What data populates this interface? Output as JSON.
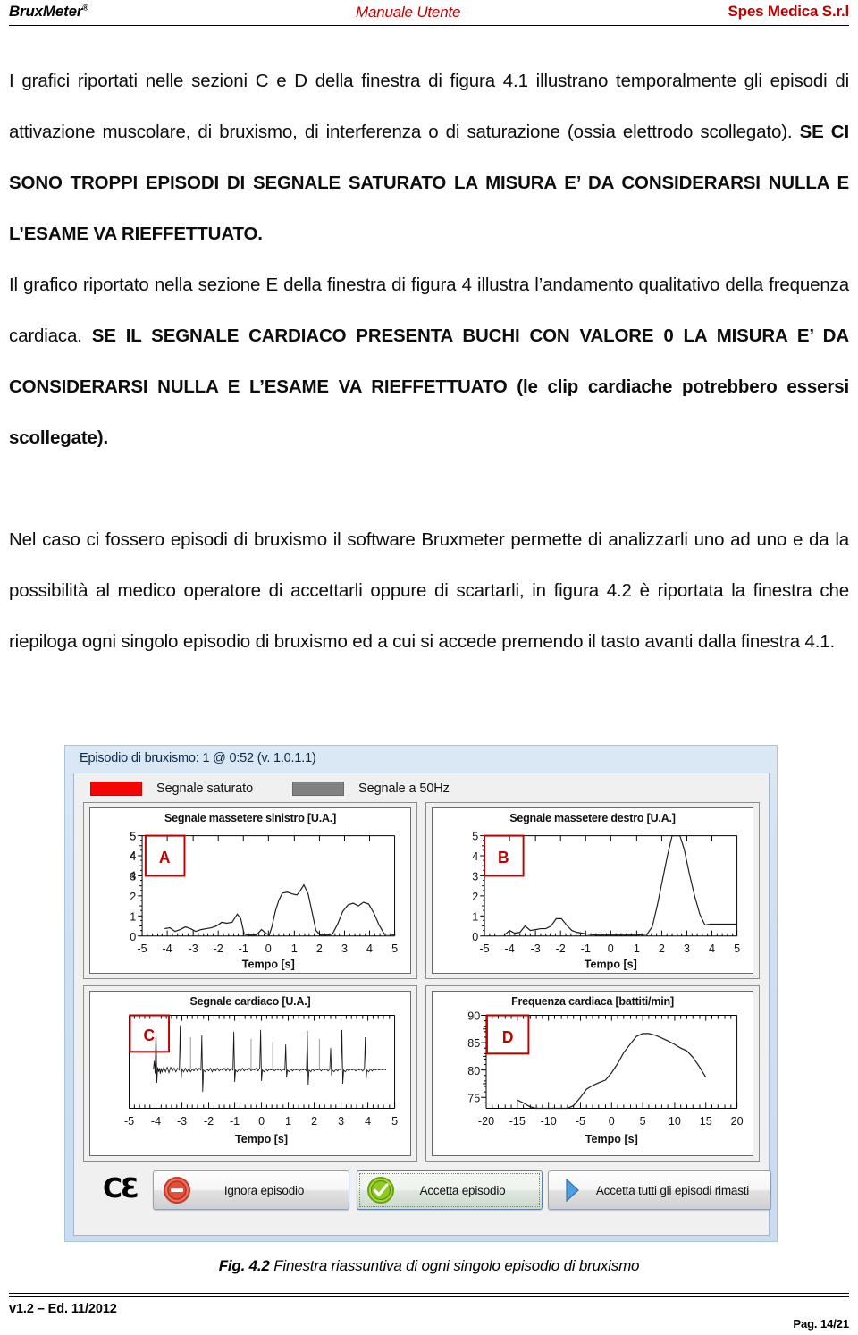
{
  "header": {
    "left": "BruxMeter",
    "left_sup": "®",
    "center": "Manuale Utente",
    "right": "Spes Medica S.r.l",
    "accent_color": "#c00000"
  },
  "body": {
    "para1_a": "I grafici riportati nelle sezioni C e D della finestra di figura 4.1 illustrano temporalmente gli episodi di attivazione muscolare, di bruxismo, di interferenza o di saturazione (ossia elettrodo scollegato). ",
    "para1_b": "SE CI SONO TROPPI EPISODI DI SEGNALE SATURATO LA MISURA E’ DA CONSIDERARSI NULLA E L’ESAME VA RIEFFETTUATO.",
    "para2_a": "Il grafico riportato nella sezione E della finestra di figura 4 illustra l’andamento qualitativo della frequenza cardiaca. ",
    "para2_b": "SE IL SEGNALE  CARDIACO PRESENTA BUCHI CON VALORE 0 LA MISURA E’ DA CONSIDERARSI NULLA E L’ESAME VA RIEFFETTUATO (le clip cardiache potrebbero essersi scollegate).",
    "para3": "Nel caso ci fossero episodi di bruxismo il software Bruxmeter permette di analizzarli uno ad uno e da la possibilità al medico operatore di accettarli oppure di scartarli, in figura 4.2 è riportata la finestra che riepiloga ogni singolo episodio di bruxismo ed a cui si accede premendo il tasto avanti dalla finestra 4.1."
  },
  "figure": {
    "window_title": "Episodio di bruxismo: 1 @ 0:52 (v. 1.0.1.1)",
    "legend": [
      {
        "label": "Segnale saturato",
        "color": "#f50505",
        "swatch": "red"
      },
      {
        "label": "Segnale a 50Hz",
        "color": "#818181",
        "swatch": "gray"
      }
    ],
    "panels": [
      {
        "badge": "A",
        "title": "Segnale massetere sinistro [U.A.]"
      },
      {
        "badge": "B",
        "title": "Segnale massetere destro [U.A.]"
      },
      {
        "badge": "C",
        "title": "Segnale cardiaco [U.A.]"
      },
      {
        "badge": "D",
        "title": "Frequenza cardiaca [battiti/min]"
      }
    ],
    "ce_mark": "CƐ",
    "buttons": [
      {
        "label": "Ignora episodio",
        "icon": "minus-circle-icon",
        "color": "#e04a3c",
        "focused": false
      },
      {
        "label": "Accetta episodio",
        "icon": "check-circle-icon",
        "color": "#7fc41c",
        "focused": true
      },
      {
        "label": "Accetta tutti gli episodi rimasti",
        "icon": "blue-arrow-icon",
        "color": "#3d8fd6",
        "focused": false
      }
    ]
  },
  "caption": {
    "bold": "Fig. 4.2",
    "text": " Finestra riassuntiva di ogni singolo episodio di bruxismo"
  },
  "footer": {
    "left": "v1.2 – Ed. 11/2012",
    "right": "Pag. 14/21"
  },
  "chart_data": [
    {
      "type": "line",
      "panel": "A",
      "title": "Segnale massetere sinistro [U.A.]",
      "xlabel": "Tempo [s]",
      "ylabel": "",
      "xlim": [
        -5,
        5
      ],
      "ylim": [
        0,
        5
      ],
      "xticks": [
        -5,
        -4,
        -3,
        -2,
        -1,
        0,
        1,
        2,
        3,
        4,
        5
      ],
      "yticks": [
        0,
        1,
        2,
        3,
        4,
        5
      ],
      "grid": false,
      "x": [
        -4.1,
        -3.9,
        -3.7,
        -3.5,
        -3.35,
        -3.2,
        -3.05,
        -2.9,
        -2.7,
        -2.5,
        -2.3,
        -2.1,
        -1.9,
        -1.7,
        -1.55,
        -1.45,
        -1.35,
        -1.2,
        -1.0,
        -0.85,
        -0.7,
        -0.6,
        -0.5,
        -0.42,
        -0.3,
        -0.15,
        0.0,
        0.2,
        0.4,
        0.55,
        0.7,
        0.85,
        1.0,
        1.1,
        1.25,
        1.5,
        1.7,
        1.85,
        2.0,
        2.2,
        2.4,
        2.6,
        2.8,
        3.0,
        3.15,
        3.3,
        3.5,
        3.8,
        4.2,
        4.7
      ],
      "y": [
        0.35,
        0.42,
        0.22,
        0.3,
        0.45,
        0.38,
        0.25,
        0.32,
        0.38,
        0.4,
        0.5,
        0.68,
        0.62,
        0.68,
        1.1,
        0.85,
        0.1,
        0.03,
        0.05,
        0.3,
        0.1,
        0.05,
        0.4,
        1.1,
        1.8,
        2.15,
        2.2,
        2.1,
        2.05,
        2.3,
        2.55,
        2.1,
        1.1,
        0.25,
        0.05,
        0.05,
        0.08,
        0.6,
        1.2,
        1.55,
        1.6,
        1.5,
        1.65,
        1.6,
        1.15,
        0.55,
        0.08,
        0.1,
        0.05,
        0.07
      ]
    },
    {
      "type": "line",
      "panel": "B",
      "title": "Segnale massetere destro [U.A.]",
      "xlabel": "Tempo [s]",
      "ylabel": "",
      "xlim": [
        -5,
        5
      ],
      "ylim": [
        0,
        5
      ],
      "xticks": [
        -5,
        -4,
        -3,
        -2,
        -1,
        0,
        1,
        2,
        3,
        4,
        5
      ],
      "yticks": [
        0,
        1,
        2,
        3,
        4,
        5
      ],
      "grid": false,
      "note": "Picco saturato oltre il fondo scala tra 2.3 e 3.0 s",
      "x": [
        -4.2,
        -4.0,
        -3.8,
        -3.6,
        -3.45,
        -3.3,
        -3.15,
        -3.0,
        -2.8,
        -2.6,
        -2.4,
        -2.2,
        -2.05,
        -1.9,
        -1.75,
        -1.6,
        -1.4,
        -1.2,
        -1.0,
        -0.6,
        -0.2,
        0.3,
        0.8,
        1.2,
        1.5,
        1.7,
        1.85,
        2.0,
        2.2,
        2.4,
        2.55,
        2.7,
        2.9,
        3.05,
        3.2,
        3.4,
        3.55,
        3.7,
        4.0
      ],
      "y": [
        0.05,
        0.25,
        0.15,
        0.18,
        0.5,
        0.28,
        0.32,
        0.35,
        0.38,
        0.6,
        0.88,
        0.8,
        0.55,
        0.3,
        0.18,
        0.12,
        0.1,
        0.06,
        0.05,
        0.04,
        0.04,
        0.04,
        0.05,
        0.05,
        0.06,
        0.1,
        0.6,
        1.6,
        2.9,
        4.2,
        5.0,
        5.0,
        4.6,
        3.4,
        2.2,
        1.1,
        0.6,
        0.58,
        0.57
      ]
    },
    {
      "type": "line",
      "panel": "C",
      "title": "Segnale cardiaco [U.A.]",
      "xlabel": "Tempo [s]",
      "ylabel": "",
      "xlim": [
        -5,
        5
      ],
      "ylim": [
        -1,
        1
      ],
      "xticks": [
        -5,
        -4,
        -3,
        -2,
        -1,
        0,
        1,
        2,
        3,
        4,
        5
      ],
      "yticks": [],
      "grid": false,
      "note": "Tracciato ECG con complessi QRS; asse y senza etichette. Picchi R circa a -4.0, -3.35, -2.55, -1.9, -1.2, -0.45, 0.15, 0.95, 1.5, 2.2, 2.95, 3.6 s"
    },
    {
      "type": "line",
      "panel": "D",
      "title": "Frequenza cardiaca [battiti/min]",
      "xlabel": "Tempo [s]",
      "ylabel": "",
      "xlim": [
        -20,
        20
      ],
      "ylim": [
        73,
        90
      ],
      "xticks": [
        -20,
        -15,
        -10,
        -5,
        0,
        5,
        10,
        15,
        20
      ],
      "yticks": [
        75,
        80,
        85,
        90
      ],
      "grid": false,
      "x": [
        -15.0,
        -14.0,
        -13.0,
        -12.0,
        -11.0,
        -10.0,
        -9.0,
        -8.0,
        -7.0,
        -6.0,
        -5.0,
        -4.0,
        -3.0,
        -2.0,
        -1.0,
        0.0,
        1.0,
        2.0,
        3.0,
        4.0,
        5.0,
        6.0,
        7.0,
        8.0,
        9.0,
        10.0,
        11.0,
        12.0,
        13.0,
        14.0,
        15.0
      ],
      "y": [
        75.2,
        74.8,
        74.2,
        73.7,
        73.6,
        73.7,
        73.6,
        73.7,
        73.5,
        74.0,
        75.0,
        76.2,
        76.8,
        77.2,
        77.6,
        78.8,
        80.5,
        82.5,
        84.3,
        85.7,
        86.0,
        86.0,
        85.8,
        85.4,
        85.0,
        84.5,
        84.0,
        83.5,
        82.4,
        80.6,
        78.6
      ]
    }
  ]
}
